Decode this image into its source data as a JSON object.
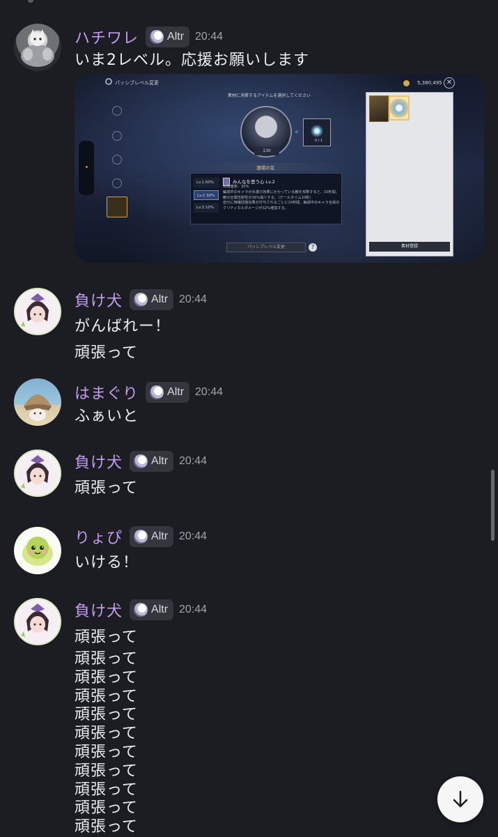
{
  "messages": [
    {
      "author": "ハチワレ",
      "badge": "Altr",
      "time": "20:44",
      "lines": [
        "いま2レベル。応援お願いします"
      ],
      "attachment": {
        "title": "パッシブレベル変更",
        "gold": "5,380,495",
        "prompt": "素材に消費するアイテムを選択してください",
        "char_level": "130",
        "slot_count": "0 / 1",
        "section_title": "酒場の花",
        "levels": [
          {
            "label": "Lv.1",
            "rate": "60%"
          },
          {
            "label": "Lv.2",
            "rate": "30%"
          },
          {
            "label": "Lv.3",
            "rate": "10%"
          }
        ],
        "skill_title": "みんなを思う心 Lv.2",
        "skill_desc": [
          "出現確率：30%",
          "編成中のキャラが水選び効果にかかっている敵を攻撃すると、10秒間、敵の全属性耐性が16%減少する。（クールタイム10秒）",
          "自分に時継回復効果が付与されるごとに10秒間、編成中のキャラ全員のクリティカルダメージが32%増加する。"
        ],
        "level_up_button": "パッシブレベル変更",
        "help": "?",
        "register_button": "素材登録"
      }
    },
    {
      "author": "負け犬",
      "badge": "Altr",
      "time": "20:44",
      "lines": [
        "がんばれー！",
        "頑張って"
      ]
    },
    {
      "author": "はまぐり",
      "badge": "Altr",
      "time": "20:44",
      "lines": [
        "ふぁいと"
      ]
    },
    {
      "author": "負け犬",
      "badge": "Altr",
      "time": "20:44",
      "lines": [
        "頑張って"
      ]
    },
    {
      "author": "りょぴ",
      "badge": "Altr",
      "time": "20:44",
      "lines": [
        "いける！"
      ]
    },
    {
      "author": "負け犬",
      "badge": "Altr",
      "time": "20:44",
      "lines": [
        "頑張って"
      ],
      "stack": [
        "頑張って",
        "頑張って",
        "頑張って",
        "頑張って",
        "頑張って",
        "頑張って",
        "頑張って",
        "頑張って",
        "頑張って",
        "頑張って"
      ]
    }
  ],
  "icons": {
    "badge": "altr-moon-icon",
    "jump": "arrow-down-icon"
  },
  "colors": {
    "background": "#1c1d22",
    "username": "#c39bf2",
    "badge_bg": "#34363d"
  }
}
